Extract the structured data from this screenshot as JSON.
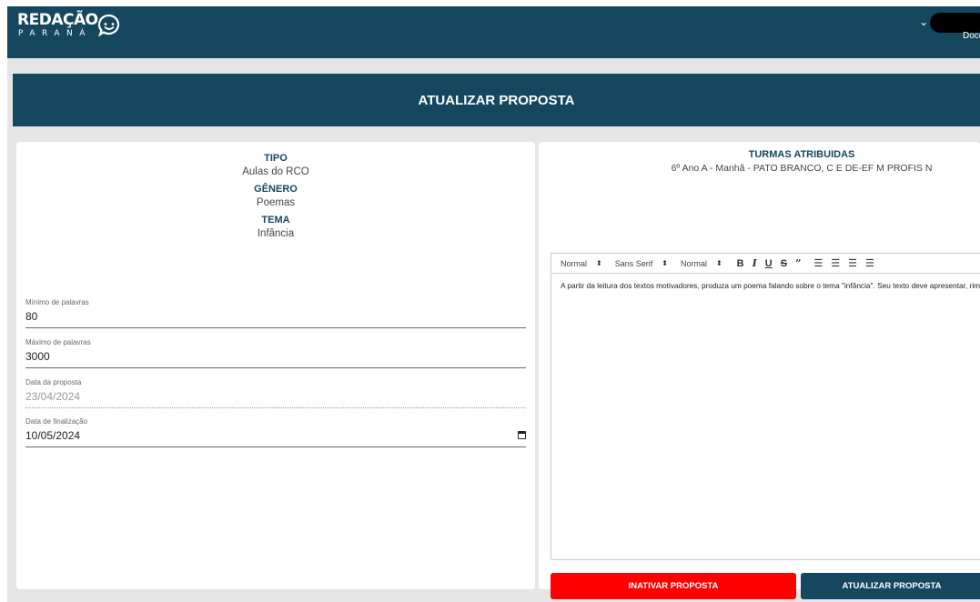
{
  "header": {
    "logo_main": "REDAÇÃO",
    "logo_sub": "PARANÁ",
    "user_role": "Doce"
  },
  "page_title": "ATUALIZAR PROPOSTA",
  "proposal": {
    "tipo_label": "TIPO",
    "tipo_value": "Aulas do RCO",
    "genero_label": "GÊNERO",
    "genero_value": "Poemas",
    "tema_label": "TEMA",
    "tema_value": "Infância"
  },
  "fields": {
    "min_words_label": "Mínimo de palavras",
    "min_words_value": "80",
    "max_words_label": "Máximo de palavras",
    "max_words_value": "3000",
    "proposal_date_label": "Data da proposta",
    "proposal_date_value": "23/04/2024",
    "end_date_label": "Data de finalização",
    "end_date_value": "10/05/2024"
  },
  "turmas": {
    "label": "TURMAS ATRIBUIDAS",
    "value": "6º Ano A - Manhã - PATO BRANCO, C E DE-EF M PROFIS N"
  },
  "editor": {
    "header_select": "Normal",
    "font_select": "Sans Serif",
    "size_select": "Normal",
    "text": "A partir da leitura dos textos motivadores, produza um poema falando sobre o tema \"infância\". Seu texto deve apresentar, rimas, versos e"
  },
  "actions": {
    "inactivate_label": "INATIVAR PROPOSTA",
    "update_label": "ATUALIZAR PROPOSTA"
  },
  "colors": {
    "primary": "#15475f",
    "danger": "#ff0000",
    "background": "#e5e5e5"
  }
}
